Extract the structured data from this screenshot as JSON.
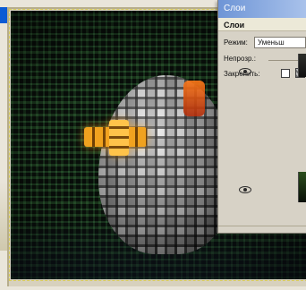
{
  "panel": {
    "window_title": "Слои",
    "tab_label": "Слои",
    "blend_mode_label": "Режим:",
    "blend_mode_value": "Уменьш",
    "opacity_label": "Непрозр.:",
    "lock_label": "Закрепить:"
  },
  "icons": {
    "eye": "eye-icon",
    "lock_transparency": "checker-icon",
    "lock_all": "lock-icon"
  },
  "colors": {
    "panel_title": "#7da0df",
    "canvas_bg": "#0c120d",
    "selection": "#d9cc58"
  }
}
